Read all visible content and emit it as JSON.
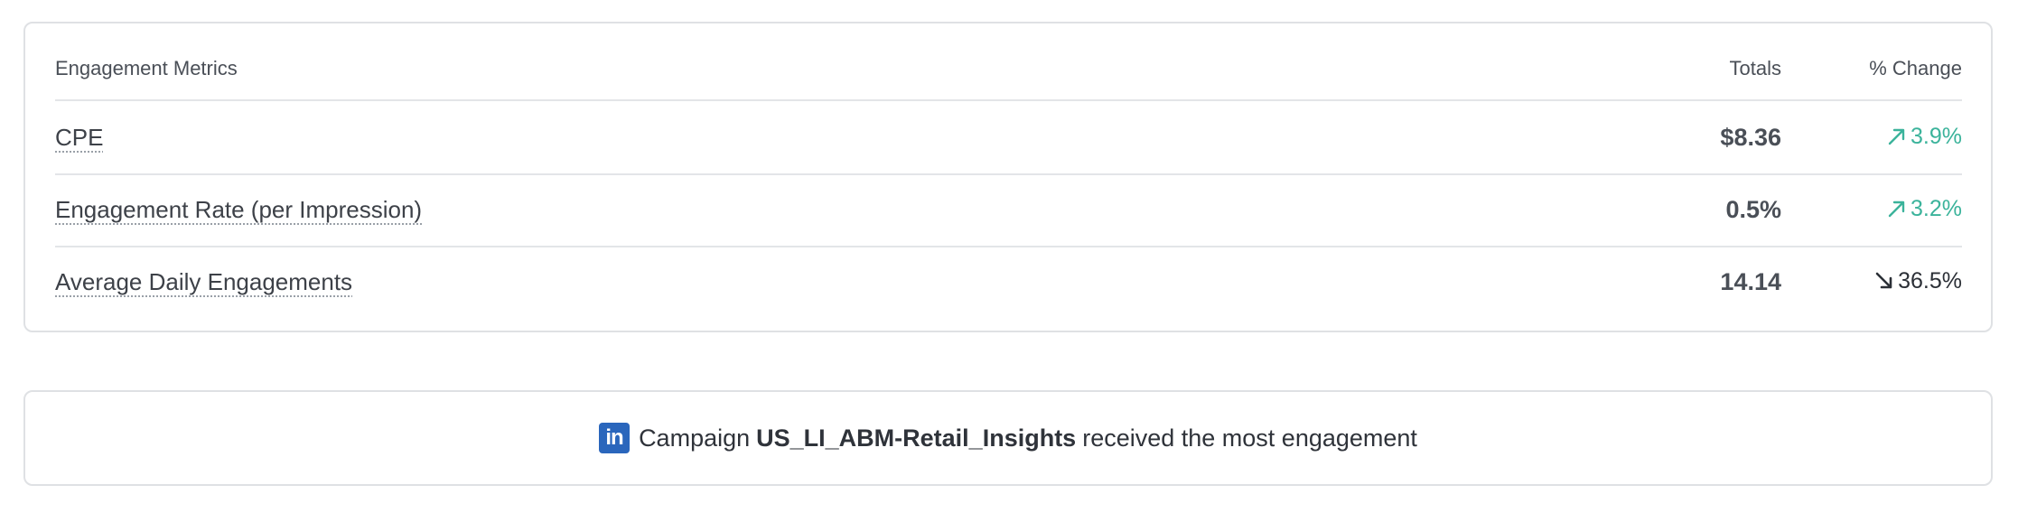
{
  "table": {
    "header_metric": "Engagement Metrics",
    "header_totals": "Totals",
    "header_change": "% Change",
    "rows": [
      {
        "name": "CPE",
        "total": "$8.36",
        "change": "3.9%",
        "direction": "up",
        "icon": "arrow-up-right-icon"
      },
      {
        "name": "Engagement Rate (per Impression)",
        "total": "0.5%",
        "change": "3.2%",
        "direction": "up",
        "icon": "arrow-up-right-icon"
      },
      {
        "name": "Average Daily Engagements",
        "total": "14.14",
        "change": "36.5%",
        "direction": "down",
        "icon": "arrow-down-right-icon"
      }
    ]
  },
  "summary": {
    "icon": "linkedin-icon",
    "logo_text": "in",
    "prefix": "Campaign",
    "campaign": "US_LI_ABM-Retail_Insights",
    "suffix": "received the most engagement"
  },
  "colors": {
    "positive": "#3bb39b",
    "negative": "#2b2f36",
    "linkedin": "#2a66bc"
  }
}
